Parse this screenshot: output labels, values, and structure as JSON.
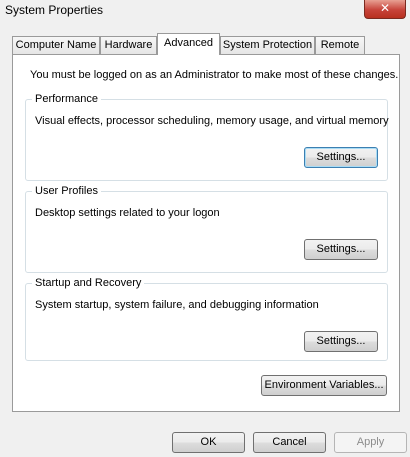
{
  "window": {
    "title": "System Properties",
    "close_glyph": "✕"
  },
  "tabs": [
    {
      "label": "Computer Name"
    },
    {
      "label": "Hardware"
    },
    {
      "label": "Advanced"
    },
    {
      "label": "System Protection"
    },
    {
      "label": "Remote"
    }
  ],
  "active_tab": "Advanced",
  "notice": "You must be logged on as an Administrator to make most of these changes.",
  "groups": [
    {
      "title": "Performance",
      "description": "Visual effects, processor scheduling, memory usage, and virtual memory",
      "button": "Settings..."
    },
    {
      "title": "User Profiles",
      "description": "Desktop settings related to your logon",
      "button": "Settings..."
    },
    {
      "title": "Startup and Recovery",
      "description": "System startup, system failure, and debugging information",
      "button": "Settings..."
    }
  ],
  "environment_button": "Environment Variables...",
  "footer": {
    "ok": "OK",
    "cancel": "Cancel",
    "apply": "Apply"
  },
  "colors": {
    "panel_bg": "#ffffff",
    "window_bg": "#f0f0f0",
    "group_border": "#d5dfe5",
    "close_button": "#c7433a"
  }
}
